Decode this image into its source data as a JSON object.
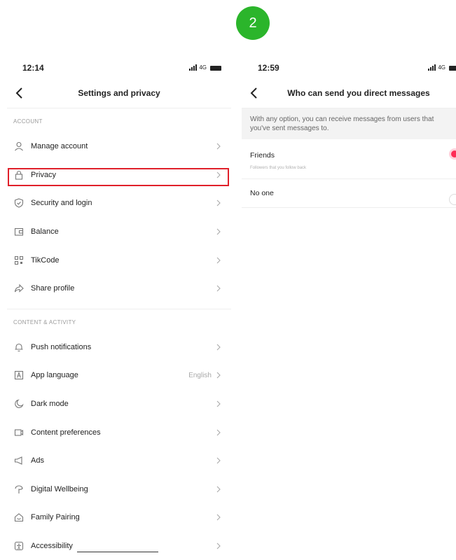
{
  "step": {
    "number": "2",
    "color": "#2bb52b"
  },
  "left_screen": {
    "status_time": "12:14",
    "network": "4G",
    "nav_title": "Settings and privacy",
    "sections": [
      {
        "header": "ACCOUNT",
        "items": [
          {
            "label": "Manage account",
            "icon": "person-icon"
          },
          {
            "label": "Privacy",
            "icon": "lock-icon",
            "highlighted": true
          },
          {
            "label": "Security and login",
            "icon": "shield-icon"
          },
          {
            "label": "Balance",
            "icon": "wallet-icon"
          },
          {
            "label": "TikCode",
            "icon": "qr-code-icon"
          },
          {
            "label": "Share profile",
            "icon": "share-icon"
          }
        ]
      },
      {
        "header": "CONTENT & ACTIVITY",
        "items": [
          {
            "label": "Push notifications",
            "icon": "bell-icon"
          },
          {
            "label": "App language",
            "icon": "language-icon",
            "value": "English"
          },
          {
            "label": "Dark mode",
            "icon": "moon-icon"
          },
          {
            "label": "Content preferences",
            "icon": "video-icon"
          },
          {
            "label": "Ads",
            "icon": "megaphone-icon"
          },
          {
            "label": "Digital Wellbeing",
            "icon": "wellbeing-icon"
          },
          {
            "label": "Family Pairing",
            "icon": "home-icon"
          },
          {
            "label": "Accessibility",
            "icon": "accessibility-icon"
          }
        ]
      }
    ],
    "highlight_color": "#e0202a"
  },
  "right_screen": {
    "status_time": "12:59",
    "network": "4G",
    "nav_title": "Who can send you direct messages",
    "info": "With any option, you can receive messages from users that you've sent messages to.",
    "options": [
      {
        "label": "Friends",
        "sublabel": "Followers that you follow back",
        "selected": true
      },
      {
        "label": "No one",
        "selected": false
      }
    ],
    "accent": "#fe2c55"
  }
}
